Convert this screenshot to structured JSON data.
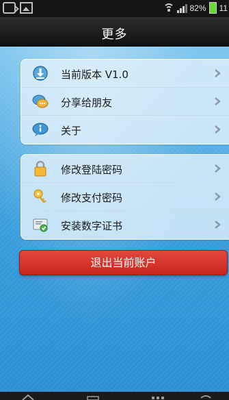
{
  "status_bar": {
    "battery_text": "82%",
    "time_partial": "11"
  },
  "header": {
    "title": "更多"
  },
  "groups": [
    {
      "items": [
        {
          "label": "当前版本 V1.0",
          "icon": "download-version-icon"
        },
        {
          "label": "分享给朋友",
          "icon": "share-friends-icon"
        },
        {
          "label": "关于",
          "icon": "info-bubble-icon"
        }
      ]
    },
    {
      "items": [
        {
          "label": "修改登陆密码",
          "icon": "lock-icon"
        },
        {
          "label": "修改支付密码",
          "icon": "key-icon"
        },
        {
          "label": "安装数字证书",
          "icon": "certificate-icon"
        }
      ]
    }
  ],
  "logout_button": {
    "label": "退出当前账户"
  },
  "colors": {
    "accent_red": "#d0322a",
    "background_blue": "#3a9edc",
    "header_dark": "#1a1a1a"
  }
}
